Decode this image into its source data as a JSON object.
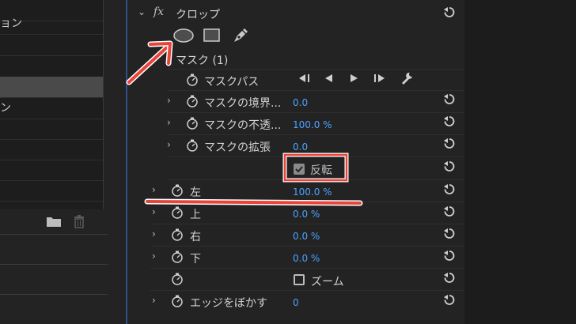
{
  "left_panel": {
    "items": [
      "",
      "ョン",
      "",
      "",
      "",
      "ン",
      "",
      "",
      "",
      ""
    ],
    "selected_index": 3
  },
  "effect": {
    "fx_label": "fx",
    "name": "クロップ",
    "mask_header": "マスク (1)",
    "mask_path_label": "マスクパス",
    "mask_props": [
      {
        "label": "マスクの境界...",
        "value": "0.0"
      },
      {
        "label": "マスクの不透...",
        "value": "100.0 %"
      },
      {
        "label": "マスクの拡張",
        "value": "0.0"
      }
    ],
    "invert_label": "反転",
    "invert_checked": true,
    "params": [
      {
        "label": "左",
        "value": "100.0 %"
      },
      {
        "label": "上",
        "value": "0.0 %"
      },
      {
        "label": "右",
        "value": "0.0 %"
      },
      {
        "label": "下",
        "value": "0.0 %"
      }
    ],
    "zoom_label": "ズーム",
    "zoom_checked": false,
    "feather_label": "エッジをぼかす",
    "feather_value": "0"
  },
  "colors": {
    "accent_blue": "#4aa3ff",
    "annotation_red": "#e8443a",
    "panel_bg": "#232323"
  }
}
